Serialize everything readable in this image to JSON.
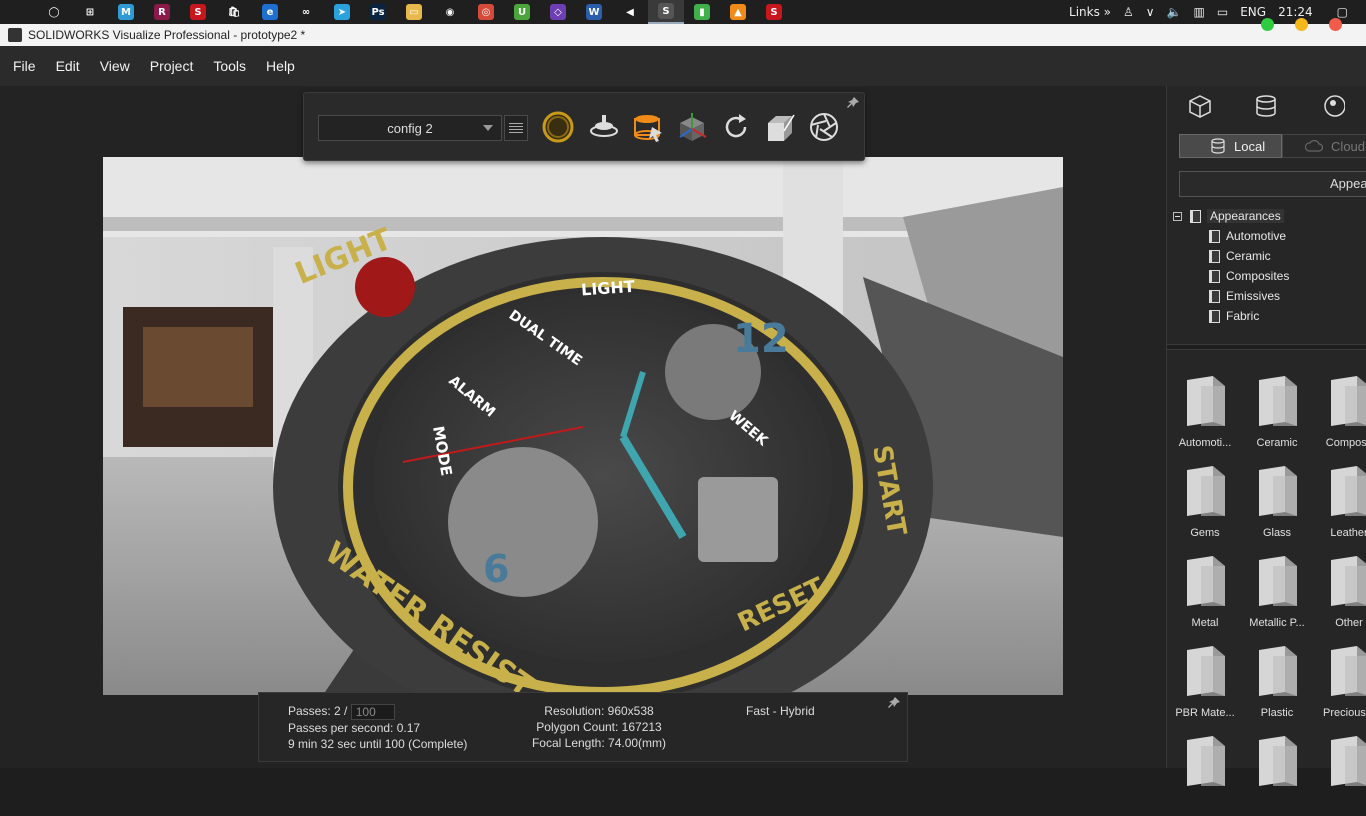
{
  "taskbar": {
    "apps": [
      {
        "icon": "apple-icon",
        "color": "#1f1f1f",
        "glyph": ""
      },
      {
        "icon": "cortana-icon",
        "color": "#1f1f1f",
        "glyph": "◯"
      },
      {
        "icon": "task-view-icon",
        "color": "#1f1f1f",
        "glyph": "⊞"
      },
      {
        "icon": "malwarebytes-icon",
        "color": "#2e9bd6",
        "glyph": "M"
      },
      {
        "icon": "winrar-icon",
        "color": "#8b1a4a",
        "glyph": "R"
      },
      {
        "icon": "solidworks-2019-icon",
        "color": "#c8161d",
        "glyph": "S"
      },
      {
        "icon": "store-icon",
        "color": "#1f1f1f",
        "glyph": "🛍"
      },
      {
        "icon": "edge-icon",
        "color": "#1f6fd1",
        "glyph": "e"
      },
      {
        "icon": "infinity-app-icon",
        "color": "#1f1f1f",
        "glyph": "∞"
      },
      {
        "icon": "telegram-icon",
        "color": "#2aa3dd",
        "glyph": "➤"
      },
      {
        "icon": "photoshop-icon",
        "color": "#0b2342",
        "glyph": "Ps"
      },
      {
        "icon": "file-explorer-icon",
        "color": "#e8b84a",
        "glyph": "▭"
      },
      {
        "icon": "obs-icon",
        "color": "#1f1f1f",
        "glyph": "◉"
      },
      {
        "icon": "chrome-icon",
        "color": "#d64a3a",
        "glyph": "◎"
      },
      {
        "icon": "utorrent-icon",
        "color": "#4aa53a",
        "glyph": "U"
      },
      {
        "icon": "visual-studio-icon",
        "color": "#6d3fb5",
        "glyph": "◇"
      },
      {
        "icon": "word-icon",
        "color": "#2a5fad",
        "glyph": "W"
      },
      {
        "icon": "media-app-icon",
        "color": "#1f1f1f",
        "glyph": "◀"
      },
      {
        "icon": "solidworks-visualize-2019-icon",
        "color": "#555555",
        "glyph": "S"
      },
      {
        "icon": "battery-app-icon",
        "color": "#3fb04a",
        "glyph": "▮"
      },
      {
        "icon": "vlc-icon",
        "color": "#f08a18",
        "glyph": "▲"
      },
      {
        "icon": "solidworks-2019-alt-icon",
        "color": "#c8161d",
        "glyph": "S"
      }
    ],
    "links_label": "Links",
    "language": "ENG",
    "time": "21:24"
  },
  "window": {
    "title": "SOLIDWORKS Visualize Professional - prototype2 *"
  },
  "menu": [
    "File",
    "Edit",
    "View",
    "Project",
    "Tools",
    "Help"
  ],
  "toolbar": {
    "config_value": "config 2",
    "tools": [
      "render-mode-icon",
      "turntable-icon",
      "environment-icon",
      "camera-axes-icon",
      "refresh-icon",
      "box-export-icon",
      "aperture-icon"
    ]
  },
  "viewport": {
    "watch_labels": [
      "LIGHT",
      "MODE",
      "WATER RESIST",
      "START",
      "RESET",
      "DUAL TIME",
      "ALARM",
      "WEEK"
    ]
  },
  "status": {
    "passes_label": "Passes: 2 /",
    "passes_target": "100",
    "passes_per_second": "Passes per second: 0.17",
    "eta": "9 min 32 sec until 100 (Complete)",
    "resolution": "Resolution: 960x538",
    "polygon_count": "Polygon Count: 167213",
    "focal_length": "Focal Length: 74.00(mm)",
    "render_mode": "Fast - Hybrid"
  },
  "right_panel": {
    "local_label": "Local",
    "cloud_label": "Cloud",
    "search_text": "Appear",
    "tree_root": "Appearances",
    "tree_children": [
      "Automotive",
      "Ceramic",
      "Composites",
      "Emissives",
      "Fabric"
    ],
    "grid": [
      "Automoti...",
      "Ceramic",
      "Composit",
      "Gems",
      "Glass",
      "Leather",
      "Metal",
      "Metallic P...",
      "Other",
      "PBR Mate...",
      "Plastic",
      "Precious...",
      "",
      "",
      ""
    ]
  }
}
